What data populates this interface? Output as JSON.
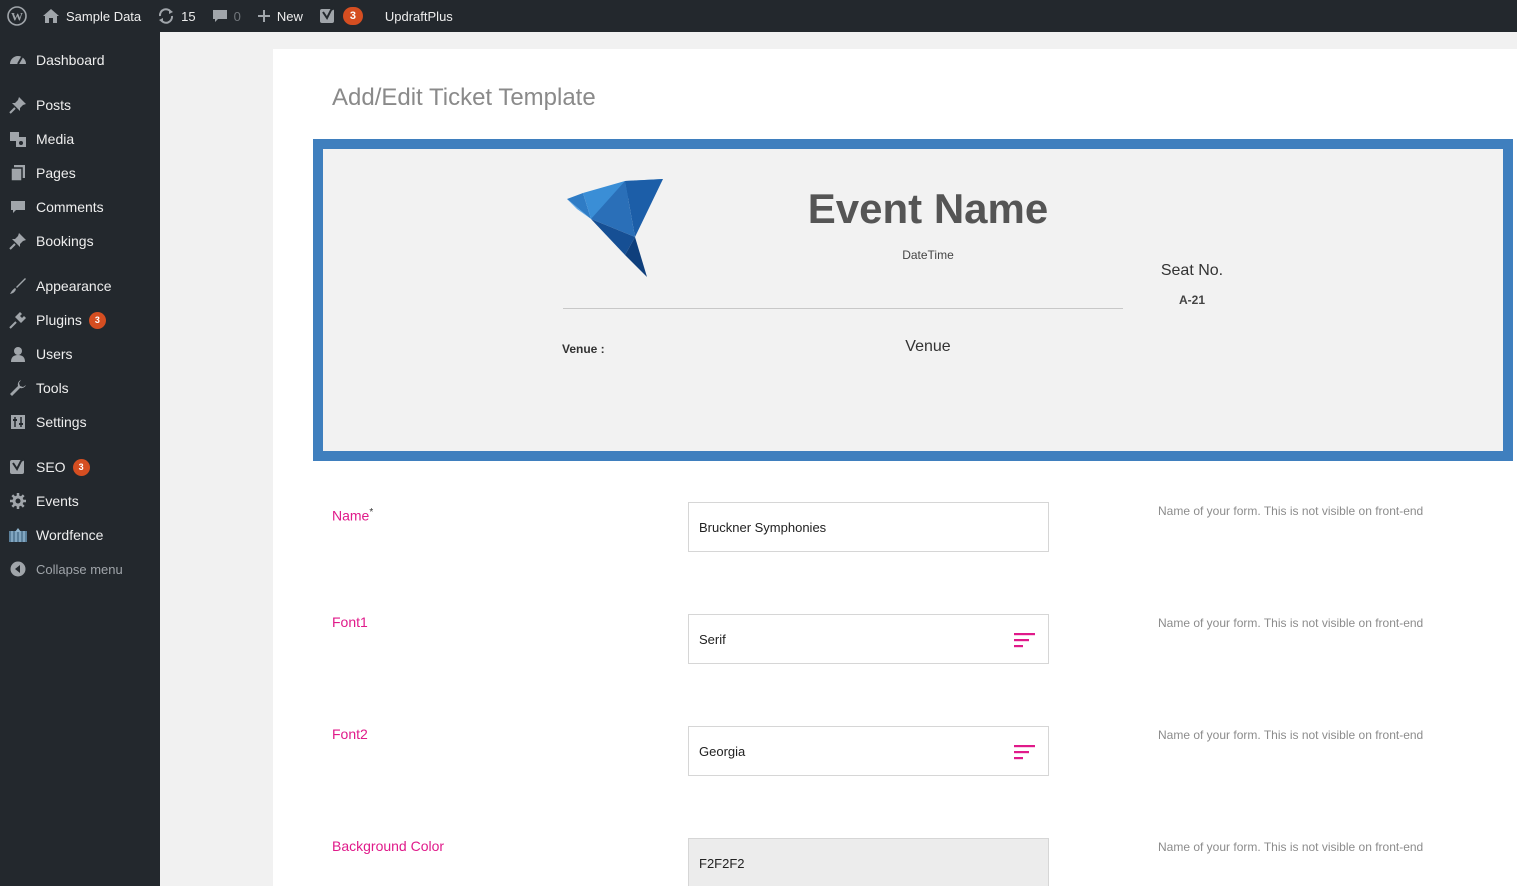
{
  "adminbar": {
    "site_name": "Sample Data",
    "updates_count": "15",
    "comments_count": "0",
    "new_label": "New",
    "seo_badge": "3",
    "updraft_label": "UpdraftPlus"
  },
  "sidebar": {
    "items": [
      {
        "label": "Dashboard",
        "icon": "dashboard-icon"
      },
      {
        "label": "Posts",
        "icon": "pin-icon"
      },
      {
        "label": "Media",
        "icon": "media-icon"
      },
      {
        "label": "Pages",
        "icon": "pages-icon"
      },
      {
        "label": "Comments",
        "icon": "comment-icon"
      },
      {
        "label": "Bookings",
        "icon": "pin-icon"
      },
      {
        "label": "Appearance",
        "icon": "brush-icon"
      },
      {
        "label": "Plugins",
        "icon": "plugin-icon",
        "badge": "3"
      },
      {
        "label": "Users",
        "icon": "user-icon"
      },
      {
        "label": "Tools",
        "icon": "wrench-icon"
      },
      {
        "label": "Settings",
        "icon": "settings-icon"
      },
      {
        "label": "SEO",
        "icon": "yoast-icon",
        "badge": "3"
      },
      {
        "label": "Events",
        "icon": "gear-icon"
      },
      {
        "label": "Wordfence",
        "icon": "wordfence-icon"
      },
      {
        "label": "Collapse menu",
        "icon": "collapse-icon"
      }
    ]
  },
  "page": {
    "title": "Add/Edit Ticket Template"
  },
  "ticket": {
    "event_name": "Event Name",
    "datetime": "DateTime",
    "venue_label": "Venue :",
    "venue_value": "Venue",
    "seat_label": "Seat No.",
    "seat_value": "A-21",
    "frame_color": "#3f7fbe",
    "background_color": "#f2f2f2"
  },
  "form": {
    "name": {
      "label": "Name",
      "required_mark": "*",
      "value": "Bruckner Symphonies",
      "help": "Name of your form. This is not visible on front-end"
    },
    "font1": {
      "label": "Font1",
      "value": "Serif",
      "help": "Name of your form. This is not visible on front-end"
    },
    "font2": {
      "label": "Font2",
      "value": "Georgia",
      "help": "Name of your form. This is not visible on front-end"
    },
    "bg_color": {
      "label": "Background Color",
      "value": "F2F2F2",
      "help": "Name of your form. This is not visible on front-end"
    }
  },
  "colors": {
    "admin_dark": "#23282d",
    "label_accent": "#e01a8a",
    "badge": "#d54e21"
  }
}
